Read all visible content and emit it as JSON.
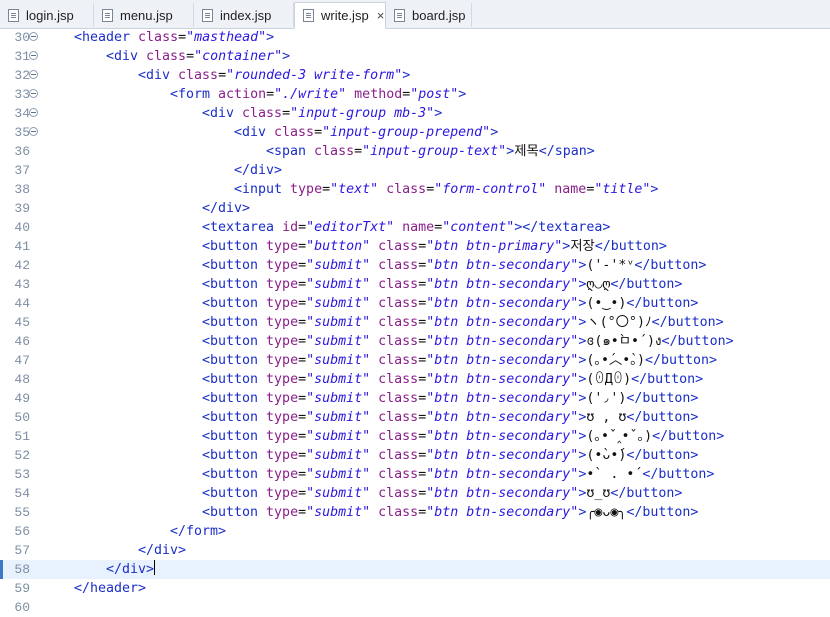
{
  "tabs": [
    {
      "label": "login.jsp",
      "active": false
    },
    {
      "label": "menu.jsp",
      "active": false
    },
    {
      "label": "index.jsp",
      "active": false
    },
    {
      "label": "write.jsp",
      "active": true,
      "close": "×"
    },
    {
      "label": "board.jsp",
      "active": false
    }
  ],
  "editor": {
    "current_line": 58,
    "lines": [
      {
        "n": "30",
        "fold": true,
        "ind": 1,
        "segs": [
          [
            "t",
            "<header "
          ],
          [
            "a",
            "class"
          ],
          [
            "x",
            "="
          ],
          [
            "v",
            "\"masthead\""
          ],
          [
            "t",
            ">"
          ]
        ]
      },
      {
        "n": "31",
        "fold": true,
        "ind": 2,
        "segs": [
          [
            "t",
            "<div "
          ],
          [
            "a",
            "class"
          ],
          [
            "x",
            "="
          ],
          [
            "v",
            "\"container\""
          ],
          [
            "t",
            ">"
          ]
        ]
      },
      {
        "n": "32",
        "fold": true,
        "ind": 3,
        "segs": [
          [
            "t",
            "<div "
          ],
          [
            "a",
            "class"
          ],
          [
            "x",
            "="
          ],
          [
            "v",
            "\"rounded-3 write-form\""
          ],
          [
            "t",
            ">"
          ]
        ]
      },
      {
        "n": "33",
        "fold": true,
        "ind": 4,
        "segs": [
          [
            "t",
            "<form "
          ],
          [
            "a",
            "action"
          ],
          [
            "x",
            "="
          ],
          [
            "v",
            "\"./write\""
          ],
          [
            "a",
            " method"
          ],
          [
            "x",
            "="
          ],
          [
            "v",
            "\"post\""
          ],
          [
            "t",
            ">"
          ]
        ]
      },
      {
        "n": "34",
        "fold": true,
        "ind": 5,
        "segs": [
          [
            "t",
            "<div "
          ],
          [
            "a",
            "class"
          ],
          [
            "x",
            "="
          ],
          [
            "v",
            "\"input-group mb-3\""
          ],
          [
            "t",
            ">"
          ]
        ]
      },
      {
        "n": "35",
        "fold": true,
        "ind": 6,
        "segs": [
          [
            "t",
            "<div "
          ],
          [
            "a",
            "class"
          ],
          [
            "x",
            "="
          ],
          [
            "v",
            "\"input-group-prepend\""
          ],
          [
            "t",
            ">"
          ]
        ]
      },
      {
        "n": "36",
        "fold": false,
        "ind": 7,
        "segs": [
          [
            "t",
            "<span "
          ],
          [
            "a",
            "class"
          ],
          [
            "x",
            "="
          ],
          [
            "v",
            "\"input-group-text\""
          ],
          [
            "t",
            ">"
          ],
          [
            "x",
            "제목"
          ],
          [
            "t",
            "</span>"
          ]
        ]
      },
      {
        "n": "37",
        "fold": false,
        "ind": 6,
        "segs": [
          [
            "t",
            "</div>"
          ]
        ]
      },
      {
        "n": "38",
        "fold": false,
        "ind": 6,
        "segs": [
          [
            "t",
            "<input "
          ],
          [
            "a",
            "type"
          ],
          [
            "x",
            "="
          ],
          [
            "v",
            "\"text\""
          ],
          [
            "a",
            " class"
          ],
          [
            "x",
            "="
          ],
          [
            "v",
            "\"form-control\""
          ],
          [
            "a",
            " name"
          ],
          [
            "x",
            "="
          ],
          [
            "v",
            "\"title\""
          ],
          [
            "t",
            ">"
          ]
        ]
      },
      {
        "n": "39",
        "fold": false,
        "ind": 5,
        "segs": [
          [
            "t",
            "</div>"
          ]
        ]
      },
      {
        "n": "40",
        "fold": false,
        "ind": 5,
        "segs": [
          [
            "t",
            "<textarea "
          ],
          [
            "a",
            "id"
          ],
          [
            "x",
            "="
          ],
          [
            "v",
            "\"editorTxt\""
          ],
          [
            "a",
            " name"
          ],
          [
            "x",
            "="
          ],
          [
            "v",
            "\"content\""
          ],
          [
            "t",
            "></textarea>"
          ]
        ]
      },
      {
        "n": "41",
        "fold": false,
        "ind": 5,
        "segs": [
          [
            "t",
            "<button "
          ],
          [
            "a",
            "type"
          ],
          [
            "x",
            "="
          ],
          [
            "v",
            "\"button\""
          ],
          [
            "a",
            " class"
          ],
          [
            "x",
            "="
          ],
          [
            "v",
            "\"btn btn-primary\""
          ],
          [
            "t",
            ">"
          ],
          [
            "x",
            "저장"
          ],
          [
            "t",
            "</button>"
          ]
        ]
      },
      {
        "n": "42",
        "fold": false,
        "ind": 5,
        "segs": [
          [
            "t",
            "<button "
          ],
          [
            "a",
            "type"
          ],
          [
            "x",
            "="
          ],
          [
            "v",
            "\"submit\""
          ],
          [
            "a",
            " class"
          ],
          [
            "x",
            "="
          ],
          [
            "v",
            "\"btn btn-secondary\""
          ],
          [
            "t",
            ">"
          ],
          [
            "x",
            "('-'*ᵛ"
          ],
          [
            "t",
            "</button>"
          ]
        ]
      },
      {
        "n": "43",
        "fold": false,
        "ind": 5,
        "segs": [
          [
            "t",
            "<button "
          ],
          [
            "a",
            "type"
          ],
          [
            "x",
            "="
          ],
          [
            "v",
            "\"submit\""
          ],
          [
            "a",
            " class"
          ],
          [
            "x",
            "="
          ],
          [
            "v",
            "\"btn btn-secondary\""
          ],
          [
            "t",
            ">"
          ],
          [
            "x",
            "ღ◡ღ"
          ],
          [
            "t",
            "</button>"
          ]
        ]
      },
      {
        "n": "44",
        "fold": false,
        "ind": 5,
        "segs": [
          [
            "t",
            "<button "
          ],
          [
            "a",
            "type"
          ],
          [
            "x",
            "="
          ],
          [
            "v",
            "\"submit\""
          ],
          [
            "a",
            " class"
          ],
          [
            "x",
            "="
          ],
          [
            "v",
            "\"btn btn-secondary\""
          ],
          [
            "t",
            ">"
          ],
          [
            "x",
            "(•‿•)"
          ],
          [
            "t",
            "</button>"
          ]
        ]
      },
      {
        "n": "45",
        "fold": false,
        "ind": 5,
        "segs": [
          [
            "t",
            "<button "
          ],
          [
            "a",
            "type"
          ],
          [
            "x",
            "="
          ],
          [
            "v",
            "\"submit\""
          ],
          [
            "a",
            " class"
          ],
          [
            "x",
            "="
          ],
          [
            "v",
            "\"btn btn-secondary\""
          ],
          [
            "t",
            ">"
          ],
          [
            "x",
            "ヽ(°〇°)ﾉ"
          ],
          [
            "t",
            "</button>"
          ]
        ]
      },
      {
        "n": "46",
        "fold": false,
        "ind": 5,
        "segs": [
          [
            "t",
            "<button "
          ],
          [
            "a",
            "type"
          ],
          [
            "x",
            "="
          ],
          [
            "v",
            "\"submit\""
          ],
          [
            "a",
            " class"
          ],
          [
            "x",
            "="
          ],
          [
            "v",
            "\"btn btn-secondary\""
          ],
          [
            "t",
            ">"
          ],
          [
            "x",
            "ɞ(๑•̀ㅁ•́)ง"
          ],
          [
            "t",
            "</button>"
          ]
        ]
      },
      {
        "n": "47",
        "fold": false,
        "ind": 5,
        "segs": [
          [
            "t",
            "<button "
          ],
          [
            "a",
            "type"
          ],
          [
            "x",
            "="
          ],
          [
            "v",
            "\"submit\""
          ],
          [
            "a",
            " class"
          ],
          [
            "x",
            "="
          ],
          [
            "v",
            "\"btn btn-secondary\""
          ],
          [
            "t",
            ">"
          ],
          [
            "x",
            "(｡•́︿•̀｡)"
          ],
          [
            "t",
            "</button>"
          ]
        ]
      },
      {
        "n": "48",
        "fold": false,
        "ind": 5,
        "segs": [
          [
            "t",
            "<button "
          ],
          [
            "a",
            "type"
          ],
          [
            "x",
            "="
          ],
          [
            "v",
            "\"submit\""
          ],
          [
            "a",
            " class"
          ],
          [
            "x",
            "="
          ],
          [
            "v",
            "\"btn btn-secondary\""
          ],
          [
            "t",
            ">"
          ],
          [
            "x",
            "(ꏿДꏿ)"
          ],
          [
            "t",
            "</button>"
          ]
        ]
      },
      {
        "n": "49",
        "fold": false,
        "ind": 5,
        "segs": [
          [
            "t",
            "<button "
          ],
          [
            "a",
            "type"
          ],
          [
            "x",
            "="
          ],
          [
            "v",
            "\"submit\""
          ],
          [
            "a",
            " class"
          ],
          [
            "x",
            "="
          ],
          [
            "v",
            "\"btn btn-secondary\""
          ],
          [
            "t",
            ">"
          ],
          [
            "x",
            "('◞')"
          ],
          [
            "t",
            "</button>"
          ]
        ]
      },
      {
        "n": "50",
        "fold": false,
        "ind": 5,
        "segs": [
          [
            "t",
            "<button "
          ],
          [
            "a",
            "type"
          ],
          [
            "x",
            "="
          ],
          [
            "v",
            "\"submit\""
          ],
          [
            "a",
            " class"
          ],
          [
            "x",
            "="
          ],
          [
            "v",
            "\"btn btn-secondary\""
          ],
          [
            "t",
            ">"
          ],
          [
            "x",
            "ʊ , ʊ"
          ],
          [
            "t",
            "</button>"
          ]
        ]
      },
      {
        "n": "51",
        "fold": false,
        "ind": 5,
        "segs": [
          [
            "t",
            "<button "
          ],
          [
            "a",
            "type"
          ],
          [
            "x",
            "="
          ],
          [
            "v",
            "\"submit\""
          ],
          [
            "a",
            " class"
          ],
          [
            "x",
            "="
          ],
          [
            "v",
            "\"btn btn-secondary\""
          ],
          [
            "t",
            ">"
          ],
          [
            "x",
            "(｡•ˇ‸•ˇ｡)"
          ],
          [
            "t",
            "</button>"
          ]
        ]
      },
      {
        "n": "52",
        "fold": false,
        "ind": 5,
        "segs": [
          [
            "t",
            "<button "
          ],
          [
            "a",
            "type"
          ],
          [
            "x",
            "="
          ],
          [
            "v",
            "\"submit\""
          ],
          [
            "a",
            " class"
          ],
          [
            "x",
            "="
          ],
          [
            "v",
            "\"btn btn-secondary\""
          ],
          [
            "t",
            ">"
          ],
          [
            "x",
            "(•̀ᴗ•́)"
          ],
          [
            "t",
            "</button>"
          ]
        ]
      },
      {
        "n": "53",
        "fold": false,
        "ind": 5,
        "segs": [
          [
            "t",
            "<button "
          ],
          [
            "a",
            "type"
          ],
          [
            "x",
            "="
          ],
          [
            "v",
            "\"submit\""
          ],
          [
            "a",
            " class"
          ],
          [
            "x",
            "="
          ],
          [
            "v",
            "\"btn btn-secondary\""
          ],
          [
            "t",
            ">"
          ],
          [
            "x",
            "•` . •´"
          ],
          [
            "t",
            "</button>"
          ]
        ]
      },
      {
        "n": "54",
        "fold": false,
        "ind": 5,
        "segs": [
          [
            "t",
            "<button "
          ],
          [
            "a",
            "type"
          ],
          [
            "x",
            "="
          ],
          [
            "v",
            "\"submit\""
          ],
          [
            "a",
            " class"
          ],
          [
            "x",
            "="
          ],
          [
            "v",
            "\"btn btn-secondary\""
          ],
          [
            "t",
            ">"
          ],
          [
            "x",
            "ʊ_ʊ"
          ],
          [
            "t",
            "</button>"
          ]
        ]
      },
      {
        "n": "55",
        "fold": false,
        "ind": 5,
        "segs": [
          [
            "t",
            "<button "
          ],
          [
            "a",
            "type"
          ],
          [
            "x",
            "="
          ],
          [
            "v",
            "\"submit\""
          ],
          [
            "a",
            " class"
          ],
          [
            "x",
            "="
          ],
          [
            "v",
            "\"btn btn-secondary\""
          ],
          [
            "t",
            ">"
          ],
          [
            "x",
            "╭◉ᴗ◉╮"
          ],
          [
            "t",
            "</button>"
          ]
        ]
      },
      {
        "n": "56",
        "fold": false,
        "ind": 4,
        "segs": [
          [
            "t",
            "</form>"
          ]
        ]
      },
      {
        "n": "57",
        "fold": false,
        "ind": 3,
        "segs": [
          [
            "t",
            "</div>"
          ]
        ]
      },
      {
        "n": "58",
        "fold": false,
        "ind": 2,
        "segs": [
          [
            "t",
            "</div>"
          ]
        ]
      },
      {
        "n": "59",
        "fold": false,
        "ind": 1,
        "segs": [
          [
            "t",
            "</header>"
          ]
        ]
      },
      {
        "n": "60",
        "fold": false,
        "ind": 0,
        "segs": []
      }
    ]
  }
}
